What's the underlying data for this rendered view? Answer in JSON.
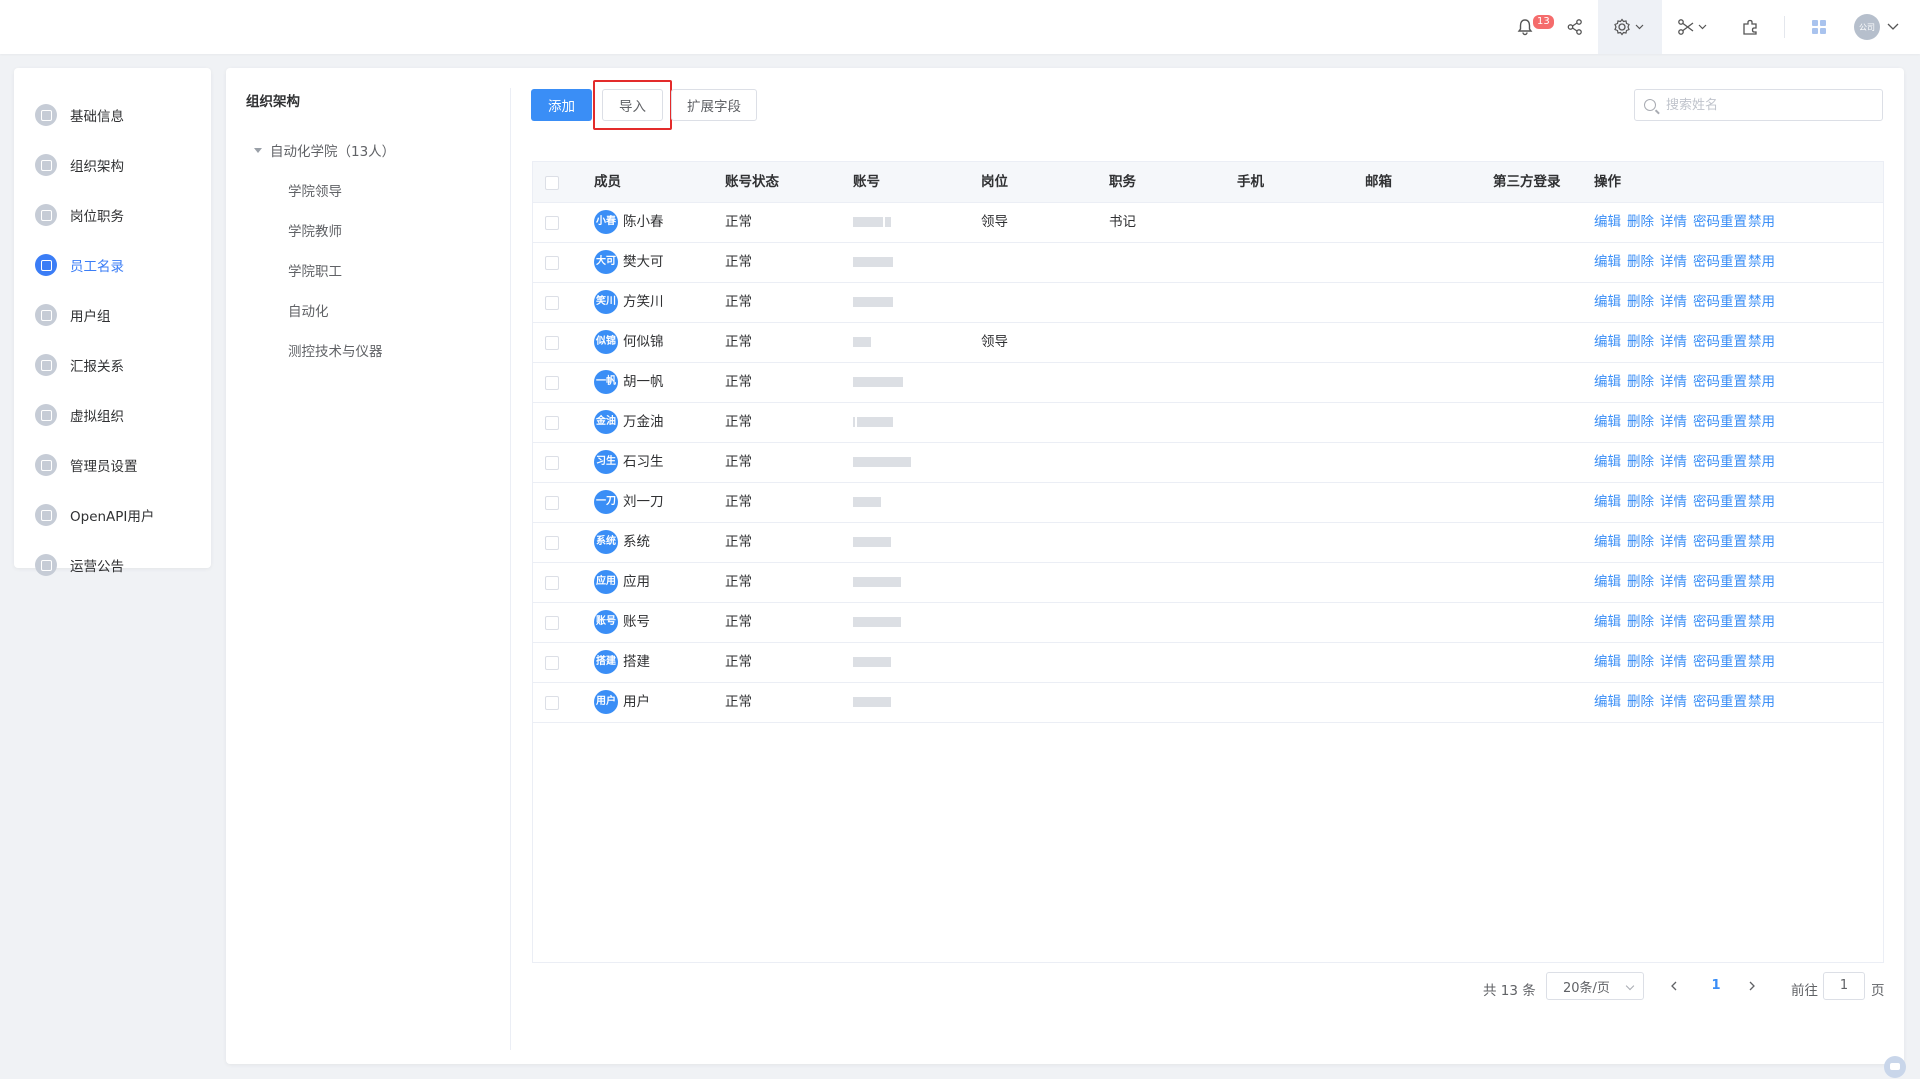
{
  "topbar": {
    "notification_count": "13",
    "avatar_text": "公司"
  },
  "sidebar": {
    "items": [
      {
        "label": "基础信息"
      },
      {
        "label": "组织架构"
      },
      {
        "label": "岗位职务"
      },
      {
        "label": "员工名录",
        "active": true
      },
      {
        "label": "用户组"
      },
      {
        "label": "汇报关系"
      },
      {
        "label": "虚拟组织"
      },
      {
        "label": "管理员设置"
      },
      {
        "label": "OpenAPI用户"
      },
      {
        "label": "运营公告"
      }
    ]
  },
  "org": {
    "title": "组织架构",
    "root": "自动化学院（13人）",
    "children": [
      "学院领导",
      "学院教师",
      "学院职工",
      "自动化",
      "测控技术与仪器"
    ]
  },
  "toolbar": {
    "add_label": "添加",
    "import_label": "导入",
    "ext_label": "扩展字段",
    "search_placeholder": "搜索姓名"
  },
  "table": {
    "headers": [
      "成员",
      "账号状态",
      "账号",
      "岗位",
      "职务",
      "手机",
      "邮箱",
      "第三方登录",
      "操作"
    ],
    "actions": [
      "编辑",
      "删除",
      "详情",
      "密码重置",
      "禁用"
    ],
    "rows": [
      {
        "avatar": "小春",
        "name": "陈小春",
        "status": "正常",
        "post": "领导",
        "duty": "书记"
      },
      {
        "avatar": "大可",
        "name": "樊大可",
        "status": "正常",
        "post": "",
        "duty": ""
      },
      {
        "avatar": "笑川",
        "name": "方笑川",
        "status": "正常",
        "post": "",
        "duty": ""
      },
      {
        "avatar": "似锦",
        "name": "何似锦",
        "status": "正常",
        "post": "领导",
        "duty": ""
      },
      {
        "avatar": "一帆",
        "name": "胡一帆",
        "status": "正常",
        "post": "",
        "duty": ""
      },
      {
        "avatar": "金油",
        "name": "万金油",
        "status": "正常",
        "post": "",
        "duty": ""
      },
      {
        "avatar": "习生",
        "name": "石习生",
        "status": "正常",
        "post": "",
        "duty": ""
      },
      {
        "avatar": "一刀",
        "name": "刘一刀",
        "status": "正常",
        "post": "",
        "duty": ""
      },
      {
        "avatar": "系统",
        "name": "系统",
        "status": "正常",
        "post": "",
        "duty": ""
      },
      {
        "avatar": "应用",
        "name": "应用",
        "status": "正常",
        "post": "",
        "duty": ""
      },
      {
        "avatar": "账号",
        "name": "账号",
        "status": "正常",
        "post": "",
        "duty": ""
      },
      {
        "avatar": "搭建",
        "name": "搭建",
        "status": "正常",
        "post": "",
        "duty": ""
      },
      {
        "avatar": "用户",
        "name": "用户",
        "status": "正常",
        "post": "",
        "duty": ""
      }
    ]
  },
  "pagination": {
    "total": "共 13 条",
    "page_size": "20条/页",
    "current_page": "1",
    "goto_label": "前往",
    "goto_value": "1",
    "page_suffix": "页"
  }
}
